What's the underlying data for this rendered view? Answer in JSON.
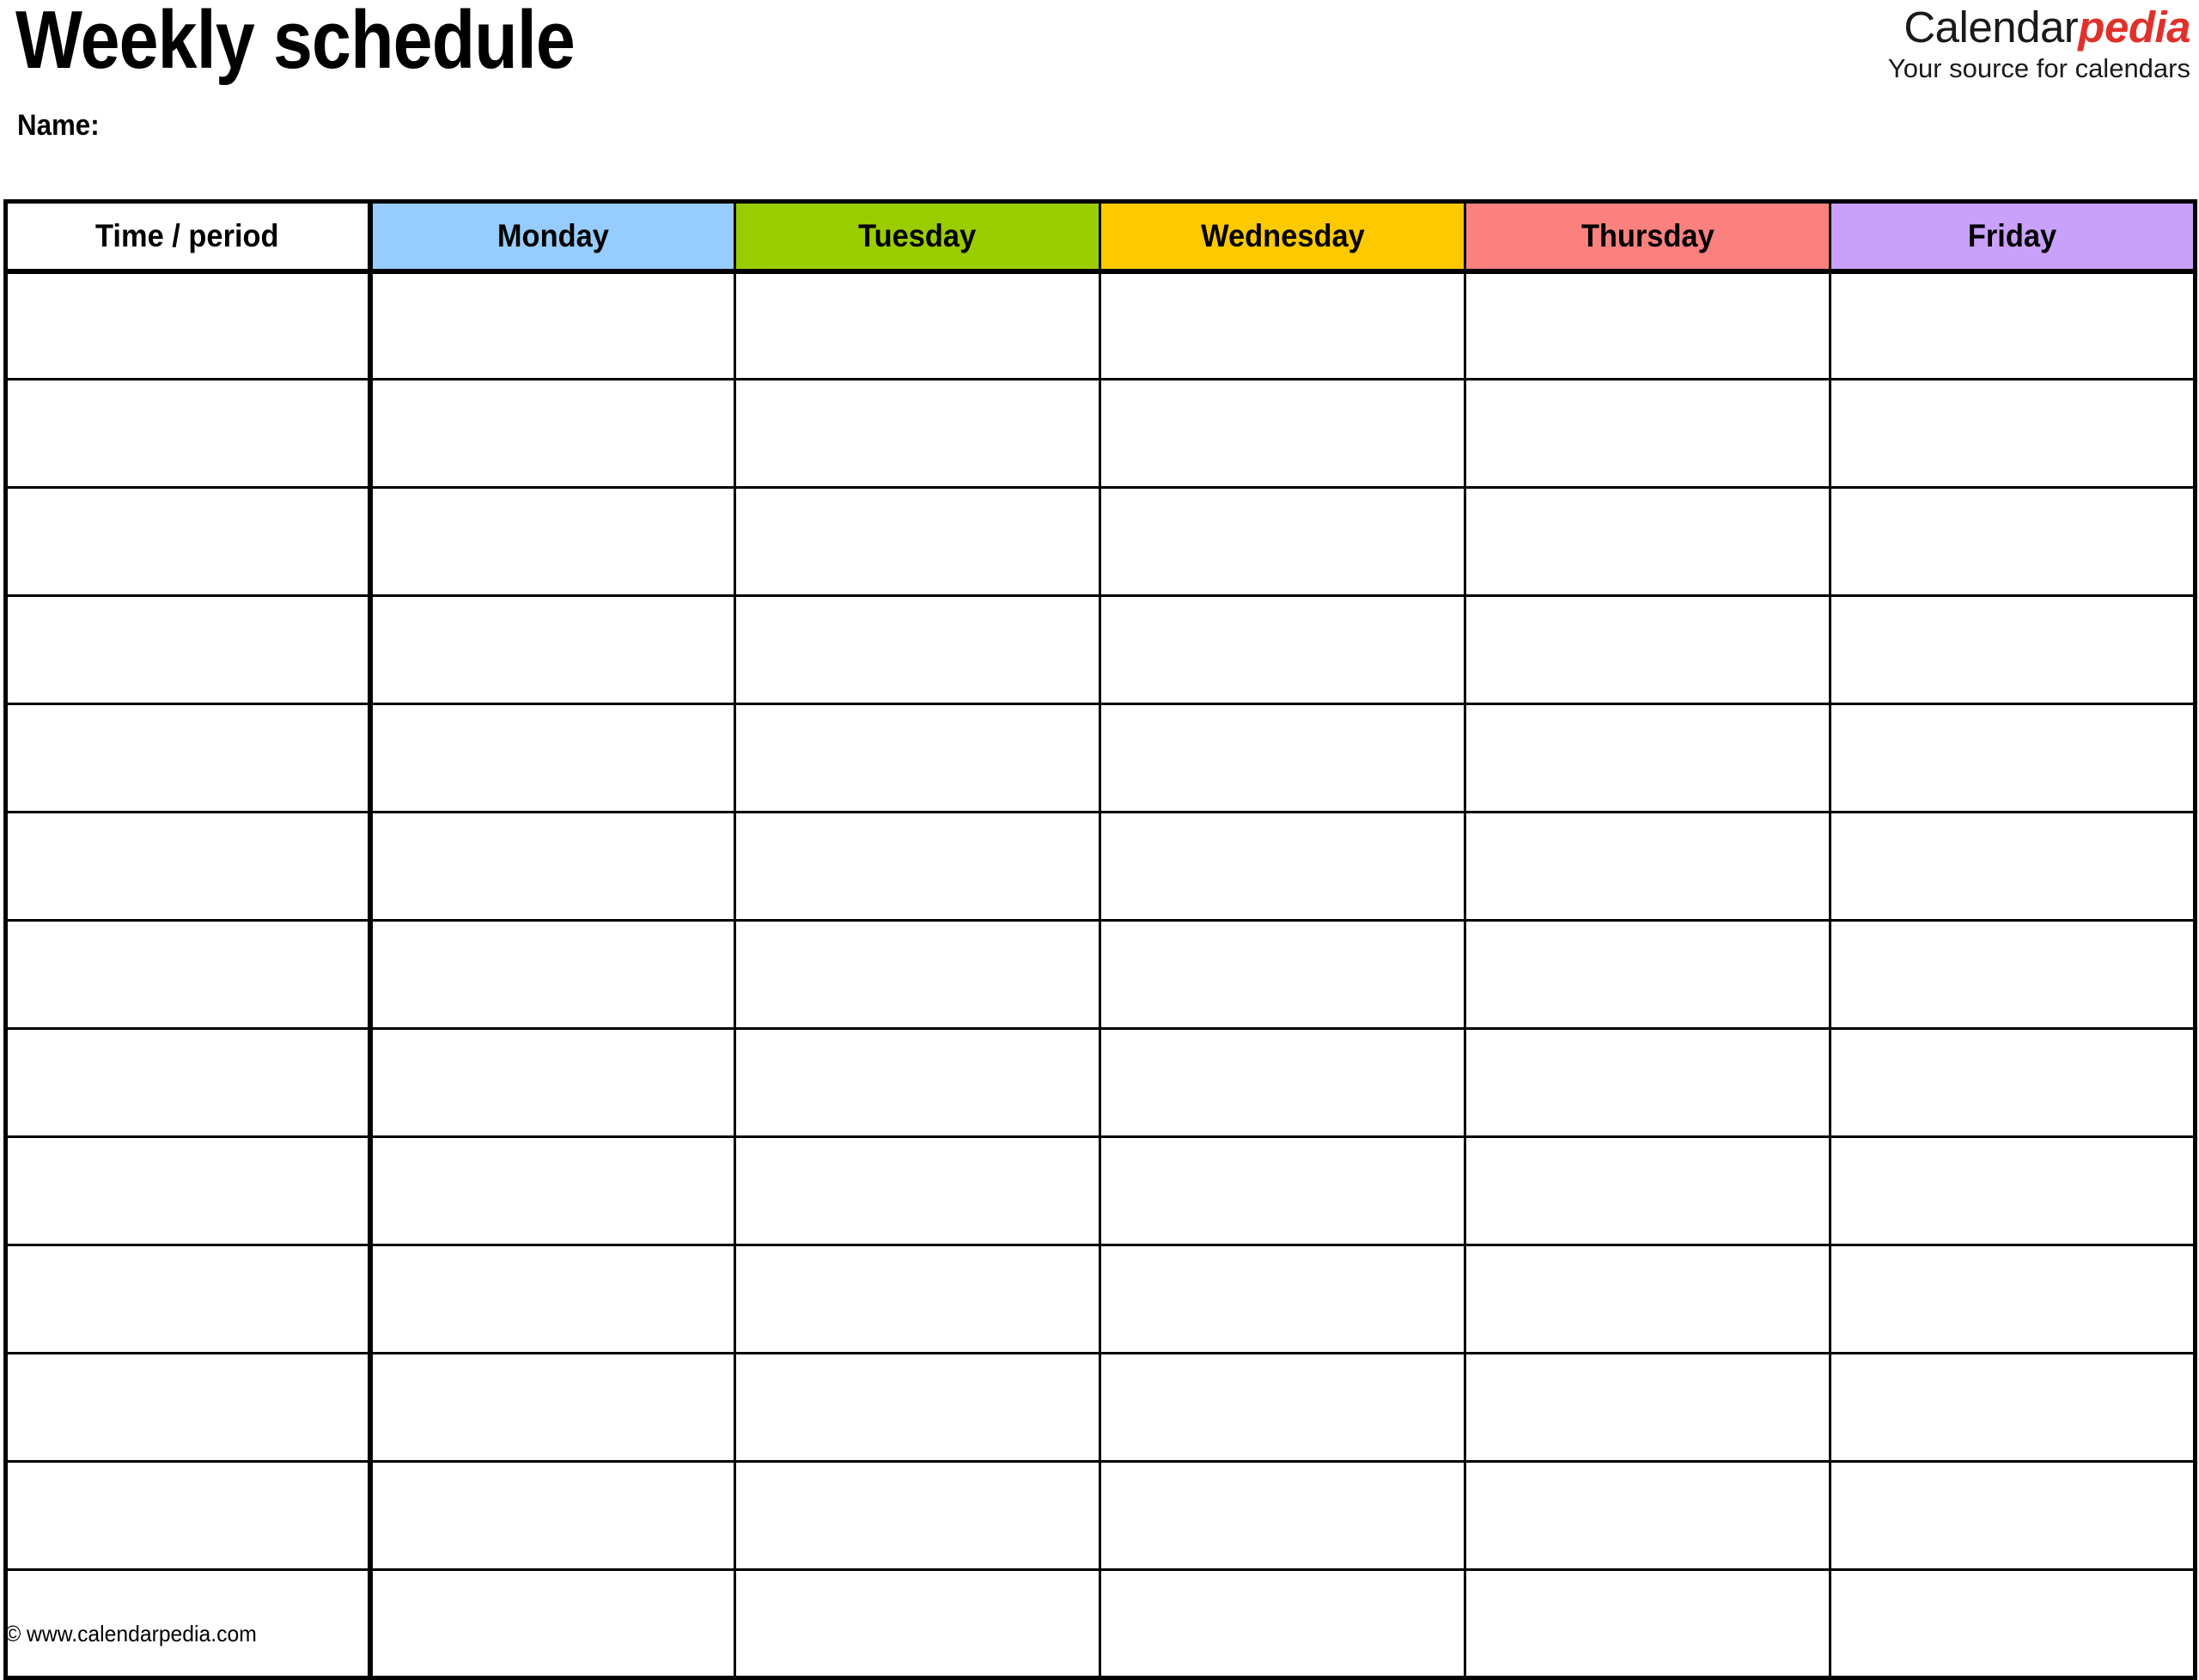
{
  "document": {
    "title": "Weekly schedule",
    "name_label": "Name:"
  },
  "brand": {
    "word_primary": "Calendar",
    "word_accent": "pedia",
    "tagline": "Your source for calendars",
    "accent_color": "#e0302a",
    "primary_color": "#1a1a1a"
  },
  "table": {
    "columns": [
      {
        "key": "time",
        "label": "Time / period",
        "bg": "#ffffff"
      },
      {
        "key": "monday",
        "label": "Monday",
        "bg": "#97ccff"
      },
      {
        "key": "tuesday",
        "label": "Tuesday",
        "bg": "#9acd00"
      },
      {
        "key": "wednesday",
        "label": "Wednesday",
        "bg": "#ffc900"
      },
      {
        "key": "thursday",
        "label": "Thursday",
        "bg": "#fa817e"
      },
      {
        "key": "friday",
        "label": "Friday",
        "bg": "#c9a0fa"
      }
    ],
    "row_count": 13,
    "rows": [
      {
        "time": "",
        "monday": "",
        "tuesday": "",
        "wednesday": "",
        "thursday": "",
        "friday": ""
      },
      {
        "time": "",
        "monday": "",
        "tuesday": "",
        "wednesday": "",
        "thursday": "",
        "friday": ""
      },
      {
        "time": "",
        "monday": "",
        "tuesday": "",
        "wednesday": "",
        "thursday": "",
        "friday": ""
      },
      {
        "time": "",
        "monday": "",
        "tuesday": "",
        "wednesday": "",
        "thursday": "",
        "friday": ""
      },
      {
        "time": "",
        "monday": "",
        "tuesday": "",
        "wednesday": "",
        "thursday": "",
        "friday": ""
      },
      {
        "time": "",
        "monday": "",
        "tuesday": "",
        "wednesday": "",
        "thursday": "",
        "friday": ""
      },
      {
        "time": "",
        "monday": "",
        "tuesday": "",
        "wednesday": "",
        "thursday": "",
        "friday": ""
      },
      {
        "time": "",
        "monday": "",
        "tuesday": "",
        "wednesday": "",
        "thursday": "",
        "friday": ""
      },
      {
        "time": "",
        "monday": "",
        "tuesday": "",
        "wednesday": "",
        "thursday": "",
        "friday": ""
      },
      {
        "time": "",
        "monday": "",
        "tuesday": "",
        "wednesday": "",
        "thursday": "",
        "friday": ""
      },
      {
        "time": "",
        "monday": "",
        "tuesday": "",
        "wednesday": "",
        "thursday": "",
        "friday": ""
      },
      {
        "time": "",
        "monday": "",
        "tuesday": "",
        "wednesday": "",
        "thursday": "",
        "friday": ""
      },
      {
        "time": "",
        "monday": "",
        "tuesday": "",
        "wednesday": "",
        "thursday": "",
        "friday": ""
      }
    ]
  },
  "footer": {
    "copyright": "© www.calendarpedia.com"
  }
}
